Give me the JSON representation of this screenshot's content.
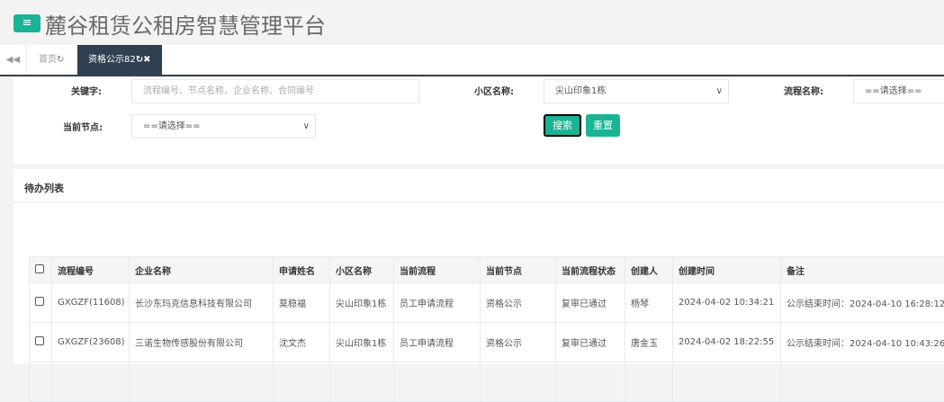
{
  "header": {
    "title": "麓谷租赁公租房智慧管理平台",
    "menu_icon": "hamburger-icon"
  },
  "tabs": [
    {
      "label": "首页"
    },
    {
      "label": "资格公示82",
      "active": true
    }
  ],
  "search": {
    "keyword_label": "关键字:",
    "keyword_placeholder": "流程编号、节点名称、企业名称、合同编号",
    "community_label": "小区名称:",
    "community_value": "尖山印象1栋",
    "process_label": "流程名称:",
    "process_value": "==请选择==",
    "node_label": "当前节点:",
    "node_value": "==请选择==",
    "search_button": "搜索",
    "reset_button": "重置"
  },
  "list": {
    "title": "待办列表",
    "columns": [
      "流程编号",
      "企业名称",
      "申请姓名",
      "小区名称",
      "当前流程",
      "当前节点",
      "当前流程状态",
      "创建人",
      "创建时间",
      "备注"
    ],
    "rows": [
      [
        "GXGZF(11608)",
        "长沙东玛克信息科技有限公司",
        "莫稳福",
        "尖山印象1栋",
        "员工申请流程",
        "资格公示",
        "复审已通过",
        "杨琴",
        "2024-04-02 10:34:21",
        "公示结束时间：2024-04-10 16:28:12"
      ],
      [
        "GXGZF(23608)",
        "三诺生物传感股份有限公司",
        "沈文杰",
        "尖山印象1栋",
        "员工申请流程",
        "资格公示",
        "复审已通过",
        "唐金玉",
        "2024-04-02 18:22:55",
        "公示结束时间：2024-04-10 10:43:26"
      ]
    ]
  },
  "colors": {
    "accent": "#1ab394",
    "tab_active": "#2f4050"
  }
}
